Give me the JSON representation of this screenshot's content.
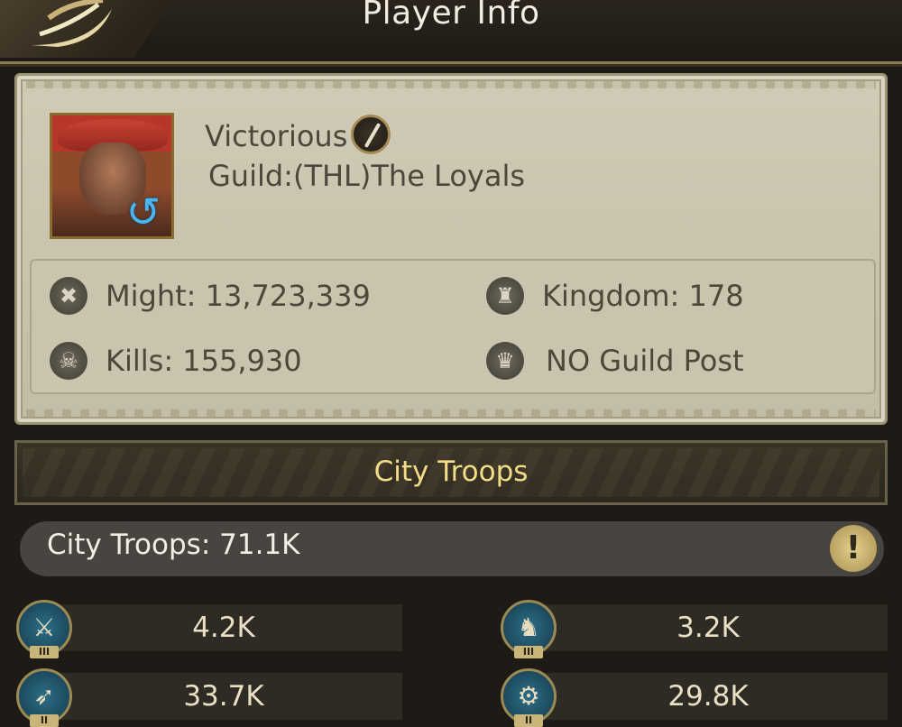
{
  "header": {
    "title": "Player Info"
  },
  "player": {
    "name": "Victorious",
    "guild": "Guild:(THL)The Loyals",
    "stats": {
      "might": "Might: 13,723,339",
      "kingdom": "Kingdom: 178",
      "kills": "Kills: 155,930",
      "guild_post": "NO Guild Post"
    }
  },
  "section": {
    "title": "City Troops"
  },
  "troops": {
    "total": "City Troops: 71.1K",
    "items": [
      {
        "icon": "swordsman-icon",
        "tier": "III",
        "value": "4.2K"
      },
      {
        "icon": "cavalry-icon",
        "tier": "III",
        "value": "3.2K"
      },
      {
        "icon": "archer-icon",
        "tier": "II",
        "value": "33.7K"
      },
      {
        "icon": "siege-icon",
        "tier": "II",
        "value": "29.8K"
      }
    ]
  }
}
